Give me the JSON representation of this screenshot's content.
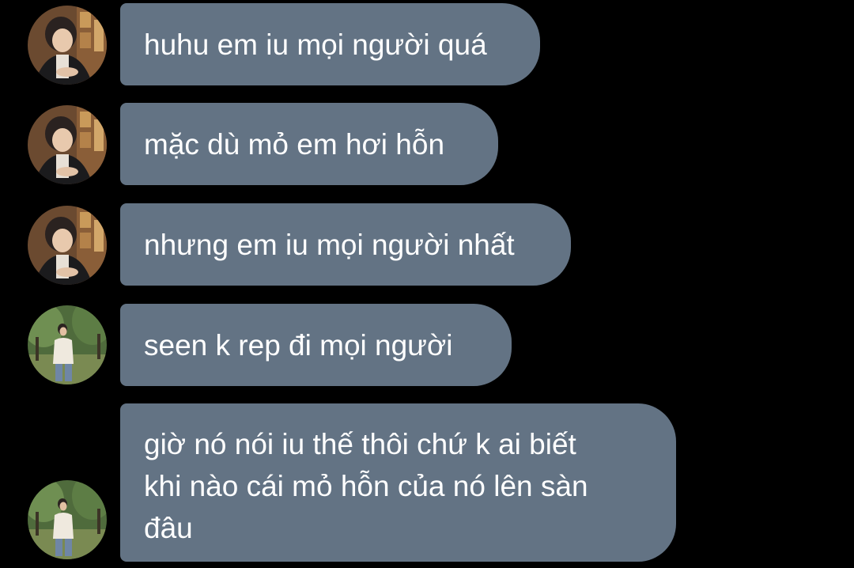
{
  "messages": [
    {
      "text": "huhu em iu mọi người quá",
      "sender": "user-a"
    },
    {
      "text": "mặc dù mỏ em hơi hỗn",
      "sender": "user-a"
    },
    {
      "text": "nhưng em iu mọi người nhất",
      "sender": "user-a"
    },
    {
      "text": "seen k rep đi mọi người",
      "sender": "user-b"
    },
    {
      "lines": [
        "giờ nó nói iu thế thôi chứ k ai biết",
        "khi nào cái mỏ hỗn của nó lên sàn",
        "đâu"
      ],
      "sender": "user-b"
    }
  ],
  "colors": {
    "background": "#000000",
    "bubble": "#637384",
    "text": "#ffffff"
  }
}
